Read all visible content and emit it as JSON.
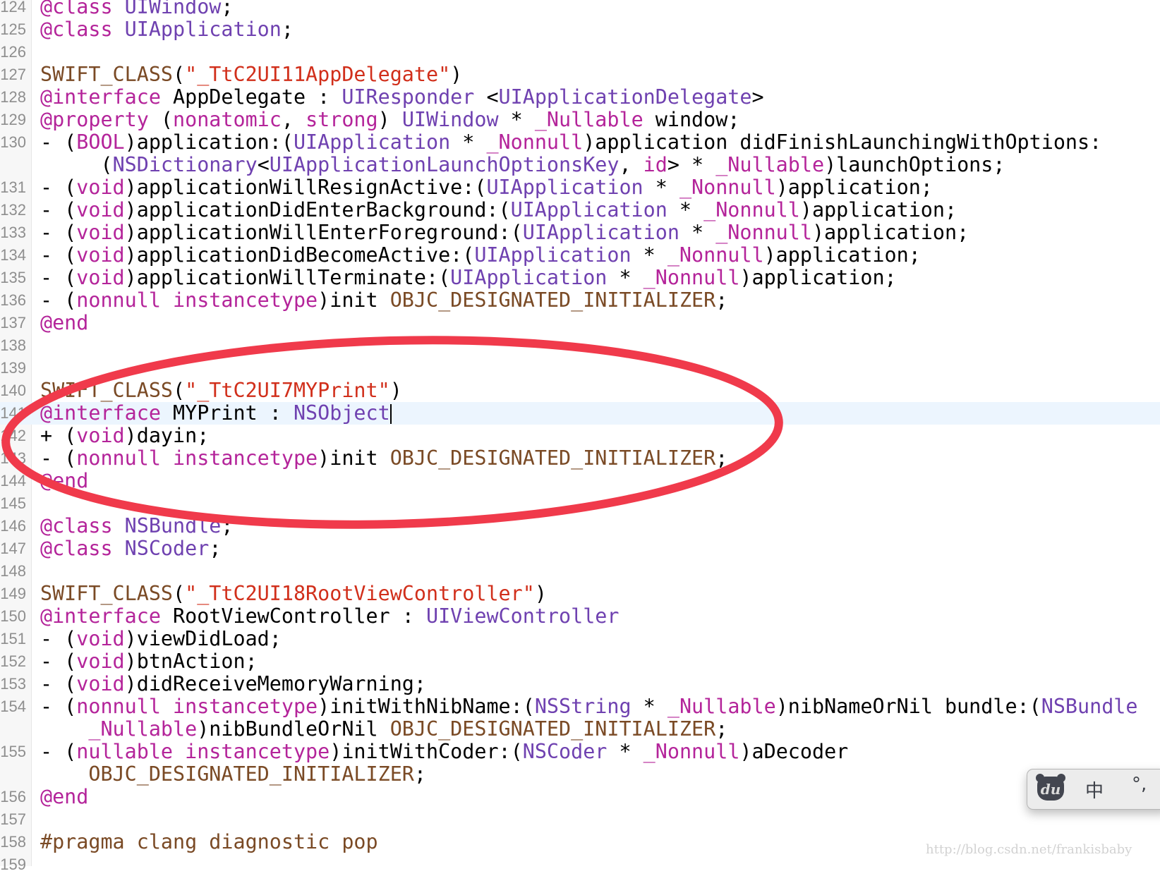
{
  "editor": {
    "current_line": 141,
    "rows": [
      {
        "num": "124",
        "tokens": [
          [
            "k",
            "@class"
          ],
          [
            "p",
            " "
          ],
          [
            "t",
            "UIWindow"
          ],
          [
            "p",
            ";"
          ]
        ]
      },
      {
        "num": "125",
        "tokens": [
          [
            "k",
            "@class"
          ],
          [
            "p",
            " "
          ],
          [
            "t",
            "UIApplication"
          ],
          [
            "p",
            ";"
          ]
        ]
      },
      {
        "num": "126",
        "tokens": []
      },
      {
        "num": "127",
        "tokens": [
          [
            "m",
            "SWIFT_CLASS"
          ],
          [
            "p",
            "("
          ],
          [
            "s",
            "\"_TtC2UI11AppDelegate\""
          ],
          [
            "p",
            ")"
          ]
        ]
      },
      {
        "num": "128",
        "tokens": [
          [
            "k",
            "@interface"
          ],
          [
            "p",
            " AppDelegate : "
          ],
          [
            "t",
            "UIResponder"
          ],
          [
            "p",
            " <"
          ],
          [
            "t",
            "UIApplicationDelegate"
          ],
          [
            "p",
            ">"
          ]
        ]
      },
      {
        "num": "129",
        "tokens": [
          [
            "k",
            "@property"
          ],
          [
            "p",
            " ("
          ],
          [
            "k",
            "nonatomic"
          ],
          [
            "p",
            ", "
          ],
          [
            "k",
            "strong"
          ],
          [
            "p",
            ") "
          ],
          [
            "t",
            "UIWindow"
          ],
          [
            "p",
            " * "
          ],
          [
            "k",
            "_Nullable"
          ],
          [
            "p",
            " window;"
          ]
        ]
      },
      {
        "num": "130",
        "tokens": [
          [
            "p",
            "- ("
          ],
          [
            "k",
            "BOOL"
          ],
          [
            "p",
            ")application:("
          ],
          [
            "t",
            "UIApplication"
          ],
          [
            "p",
            " * "
          ],
          [
            "k",
            "_Nonnull"
          ],
          [
            "p",
            ")application didFinishLaunchingWithOptions:"
          ]
        ]
      },
      {
        "num": "",
        "tokens": [
          [
            "p",
            "     ("
          ],
          [
            "t",
            "NSDictionary"
          ],
          [
            "p",
            "<"
          ],
          [
            "t",
            "UIApplicationLaunchOptionsKey"
          ],
          [
            "p",
            ", "
          ],
          [
            "k",
            "id"
          ],
          [
            "p",
            "> * "
          ],
          [
            "k",
            "_Nullable"
          ],
          [
            "p",
            ")launchOptions;"
          ]
        ]
      },
      {
        "num": "131",
        "tokens": [
          [
            "p",
            "- ("
          ],
          [
            "k",
            "void"
          ],
          [
            "p",
            ")applicationWillResignActive:("
          ],
          [
            "t",
            "UIApplication"
          ],
          [
            "p",
            " * "
          ],
          [
            "k",
            "_Nonnull"
          ],
          [
            "p",
            ")application;"
          ]
        ]
      },
      {
        "num": "132",
        "tokens": [
          [
            "p",
            "- ("
          ],
          [
            "k",
            "void"
          ],
          [
            "p",
            ")applicationDidEnterBackground:("
          ],
          [
            "t",
            "UIApplication"
          ],
          [
            "p",
            " * "
          ],
          [
            "k",
            "_Nonnull"
          ],
          [
            "p",
            ")application;"
          ]
        ]
      },
      {
        "num": "133",
        "tokens": [
          [
            "p",
            "- ("
          ],
          [
            "k",
            "void"
          ],
          [
            "p",
            ")applicationWillEnterForeground:("
          ],
          [
            "t",
            "UIApplication"
          ],
          [
            "p",
            " * "
          ],
          [
            "k",
            "_Nonnull"
          ],
          [
            "p",
            ")application;"
          ]
        ]
      },
      {
        "num": "134",
        "tokens": [
          [
            "p",
            "- ("
          ],
          [
            "k",
            "void"
          ],
          [
            "p",
            ")applicationDidBecomeActive:("
          ],
          [
            "t",
            "UIApplication"
          ],
          [
            "p",
            " * "
          ],
          [
            "k",
            "_Nonnull"
          ],
          [
            "p",
            ")application;"
          ]
        ]
      },
      {
        "num": "135",
        "tokens": [
          [
            "p",
            "- ("
          ],
          [
            "k",
            "void"
          ],
          [
            "p",
            ")applicationWillTerminate:("
          ],
          [
            "t",
            "UIApplication"
          ],
          [
            "p",
            " * "
          ],
          [
            "k",
            "_Nonnull"
          ],
          [
            "p",
            ")application;"
          ]
        ]
      },
      {
        "num": "136",
        "tokens": [
          [
            "p",
            "- ("
          ],
          [
            "k",
            "nonnull"
          ],
          [
            "p",
            " "
          ],
          [
            "k",
            "instancetype"
          ],
          [
            "p",
            ")init "
          ],
          [
            "m",
            "OBJC_DESIGNATED_INITIALIZER"
          ],
          [
            "p",
            ";"
          ]
        ]
      },
      {
        "num": "137",
        "tokens": [
          [
            "k",
            "@end"
          ]
        ]
      },
      {
        "num": "138",
        "tokens": []
      },
      {
        "num": "139",
        "tokens": []
      },
      {
        "num": "140",
        "tokens": [
          [
            "m",
            "SWIFT_CLASS"
          ],
          [
            "p",
            "("
          ],
          [
            "s",
            "\"_TtC2UI7MYPrint\""
          ],
          [
            "p",
            ")"
          ]
        ]
      },
      {
        "num": "141",
        "tokens": [
          [
            "k",
            "@interface"
          ],
          [
            "p",
            " MYPrint : "
          ],
          [
            "t",
            "NSObject"
          ]
        ],
        "cursor": true
      },
      {
        "num": "142",
        "tokens": [
          [
            "p",
            "+ ("
          ],
          [
            "k",
            "void"
          ],
          [
            "p",
            ")dayin;"
          ]
        ]
      },
      {
        "num": "143",
        "tokens": [
          [
            "p",
            "- ("
          ],
          [
            "k",
            "nonnull"
          ],
          [
            "p",
            " "
          ],
          [
            "k",
            "instancetype"
          ],
          [
            "p",
            ")init "
          ],
          [
            "m",
            "OBJC_DESIGNATED_INITIALIZER"
          ],
          [
            "p",
            ";"
          ]
        ]
      },
      {
        "num": "144",
        "tokens": [
          [
            "k",
            "@end"
          ]
        ]
      },
      {
        "num": "145",
        "tokens": []
      },
      {
        "num": "146",
        "tokens": [
          [
            "k",
            "@class"
          ],
          [
            "p",
            " "
          ],
          [
            "t",
            "NSBundle"
          ],
          [
            "p",
            ";"
          ]
        ]
      },
      {
        "num": "147",
        "tokens": [
          [
            "k",
            "@class"
          ],
          [
            "p",
            " "
          ],
          [
            "t",
            "NSCoder"
          ],
          [
            "p",
            ";"
          ]
        ]
      },
      {
        "num": "148",
        "tokens": []
      },
      {
        "num": "149",
        "tokens": [
          [
            "m",
            "SWIFT_CLASS"
          ],
          [
            "p",
            "("
          ],
          [
            "s",
            "\"_TtC2UI18RootViewController\""
          ],
          [
            "p",
            ")"
          ]
        ]
      },
      {
        "num": "150",
        "tokens": [
          [
            "k",
            "@interface"
          ],
          [
            "p",
            " RootViewController : "
          ],
          [
            "t",
            "UIViewController"
          ]
        ]
      },
      {
        "num": "151",
        "tokens": [
          [
            "p",
            "- ("
          ],
          [
            "k",
            "void"
          ],
          [
            "p",
            ")viewDidLoad;"
          ]
        ]
      },
      {
        "num": "152",
        "tokens": [
          [
            "p",
            "- ("
          ],
          [
            "k",
            "void"
          ],
          [
            "p",
            ")btnAction;"
          ]
        ]
      },
      {
        "num": "153",
        "tokens": [
          [
            "p",
            "- ("
          ],
          [
            "k",
            "void"
          ],
          [
            "p",
            ")didReceiveMemoryWarning;"
          ]
        ]
      },
      {
        "num": "154",
        "tokens": [
          [
            "p",
            "- ("
          ],
          [
            "k",
            "nonnull"
          ],
          [
            "p",
            " "
          ],
          [
            "k",
            "instancetype"
          ],
          [
            "p",
            ")initWithNibName:("
          ],
          [
            "t",
            "NSString"
          ],
          [
            "p",
            " * "
          ],
          [
            "k",
            "_Nullable"
          ],
          [
            "p",
            ")nibNameOrNil bundle:("
          ],
          [
            "t",
            "NSBundle"
          ]
        ]
      },
      {
        "num": "",
        "tokens": [
          [
            "p",
            "    "
          ],
          [
            "k",
            "_Nullable"
          ],
          [
            "p",
            ")nibBundleOrNil "
          ],
          [
            "m",
            "OBJC_DESIGNATED_INITIALIZER"
          ],
          [
            "p",
            ";"
          ]
        ]
      },
      {
        "num": "155",
        "tokens": [
          [
            "p",
            "- ("
          ],
          [
            "k",
            "nullable"
          ],
          [
            "p",
            " "
          ],
          [
            "k",
            "instancetype"
          ],
          [
            "p",
            ")initWithCoder:("
          ],
          [
            "t",
            "NSCoder"
          ],
          [
            "p",
            " * "
          ],
          [
            "k",
            "_Nonnull"
          ],
          [
            "p",
            ")aDecoder"
          ]
        ]
      },
      {
        "num": "",
        "tokens": [
          [
            "p",
            "    "
          ],
          [
            "m",
            "OBJC_DESIGNATED_INITIALIZER"
          ],
          [
            "p",
            ";"
          ]
        ]
      },
      {
        "num": "156",
        "tokens": [
          [
            "k",
            "@end"
          ]
        ]
      },
      {
        "num": "157",
        "tokens": []
      },
      {
        "num": "158",
        "tokens": [
          [
            "m",
            "#pragma clang diagnostic pop"
          ]
        ]
      },
      {
        "num": "159",
        "tokens": []
      }
    ]
  },
  "annotation": {
    "shape": "ellipse",
    "color": "#f03a4b",
    "encircles_lines": [
      140,
      144
    ]
  },
  "ime": {
    "logo_text": "du",
    "mode_label": "中",
    "punct_label": "°,",
    "logo_icon": "baidu-bear-icon"
  },
  "watermark": "http://blog.csdn.net/frankisbaby",
  "colors": {
    "keyword": "#b4249a",
    "type": "#6f41b0",
    "string": "#d12f1b",
    "macro": "#7a4a25",
    "current_line": "#ecf5fe"
  }
}
